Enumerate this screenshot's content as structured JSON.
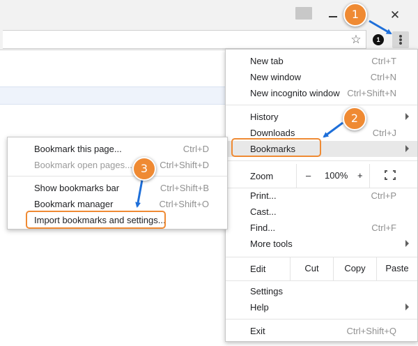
{
  "window": {
    "close_glyph": "✕"
  },
  "toolbar": {
    "star_glyph": "☆",
    "extension_badge": "1"
  },
  "menu": {
    "items_top": [
      {
        "label": "New tab",
        "shortcut": "Ctrl+T"
      },
      {
        "label": "New window",
        "shortcut": "Ctrl+N"
      },
      {
        "label": "New incognito window",
        "shortcut": "Ctrl+Shift+N"
      }
    ],
    "history": {
      "label": "History"
    },
    "downloads": {
      "label": "Downloads",
      "shortcut": "Ctrl+J"
    },
    "bookmarks": {
      "label": "Bookmarks"
    },
    "zoom": {
      "label": "Zoom",
      "minus": "–",
      "value": "100%",
      "plus": "+"
    },
    "items_mid": [
      {
        "label": "Print...",
        "shortcut": "Ctrl+P"
      },
      {
        "label": "Cast...",
        "shortcut": ""
      },
      {
        "label": "Find...",
        "shortcut": "Ctrl+F"
      }
    ],
    "more_tools": {
      "label": "More tools"
    },
    "edit": {
      "label": "Edit",
      "cut": "Cut",
      "copy": "Copy",
      "paste": "Paste"
    },
    "settings": {
      "label": "Settings"
    },
    "help": {
      "label": "Help"
    },
    "exit": {
      "label": "Exit",
      "shortcut": "Ctrl+Shift+Q"
    }
  },
  "submenu": {
    "bookmark_page": {
      "label": "Bookmark this page...",
      "shortcut": "Ctrl+D"
    },
    "bookmark_open": {
      "label": "Bookmark open pages...",
      "shortcut": "Ctrl+Shift+D"
    },
    "show_bar": {
      "label": "Show bookmarks bar",
      "shortcut": "Ctrl+Shift+B"
    },
    "manager": {
      "label": "Bookmark manager",
      "shortcut": "Ctrl+Shift+O"
    },
    "import": {
      "label": "Import bookmarks and settings..."
    }
  },
  "annotations": {
    "step1": "1",
    "step2": "2",
    "step3": "3"
  },
  "colors": {
    "callout": "#ef8a33",
    "arrow": "#1e6fd9"
  }
}
